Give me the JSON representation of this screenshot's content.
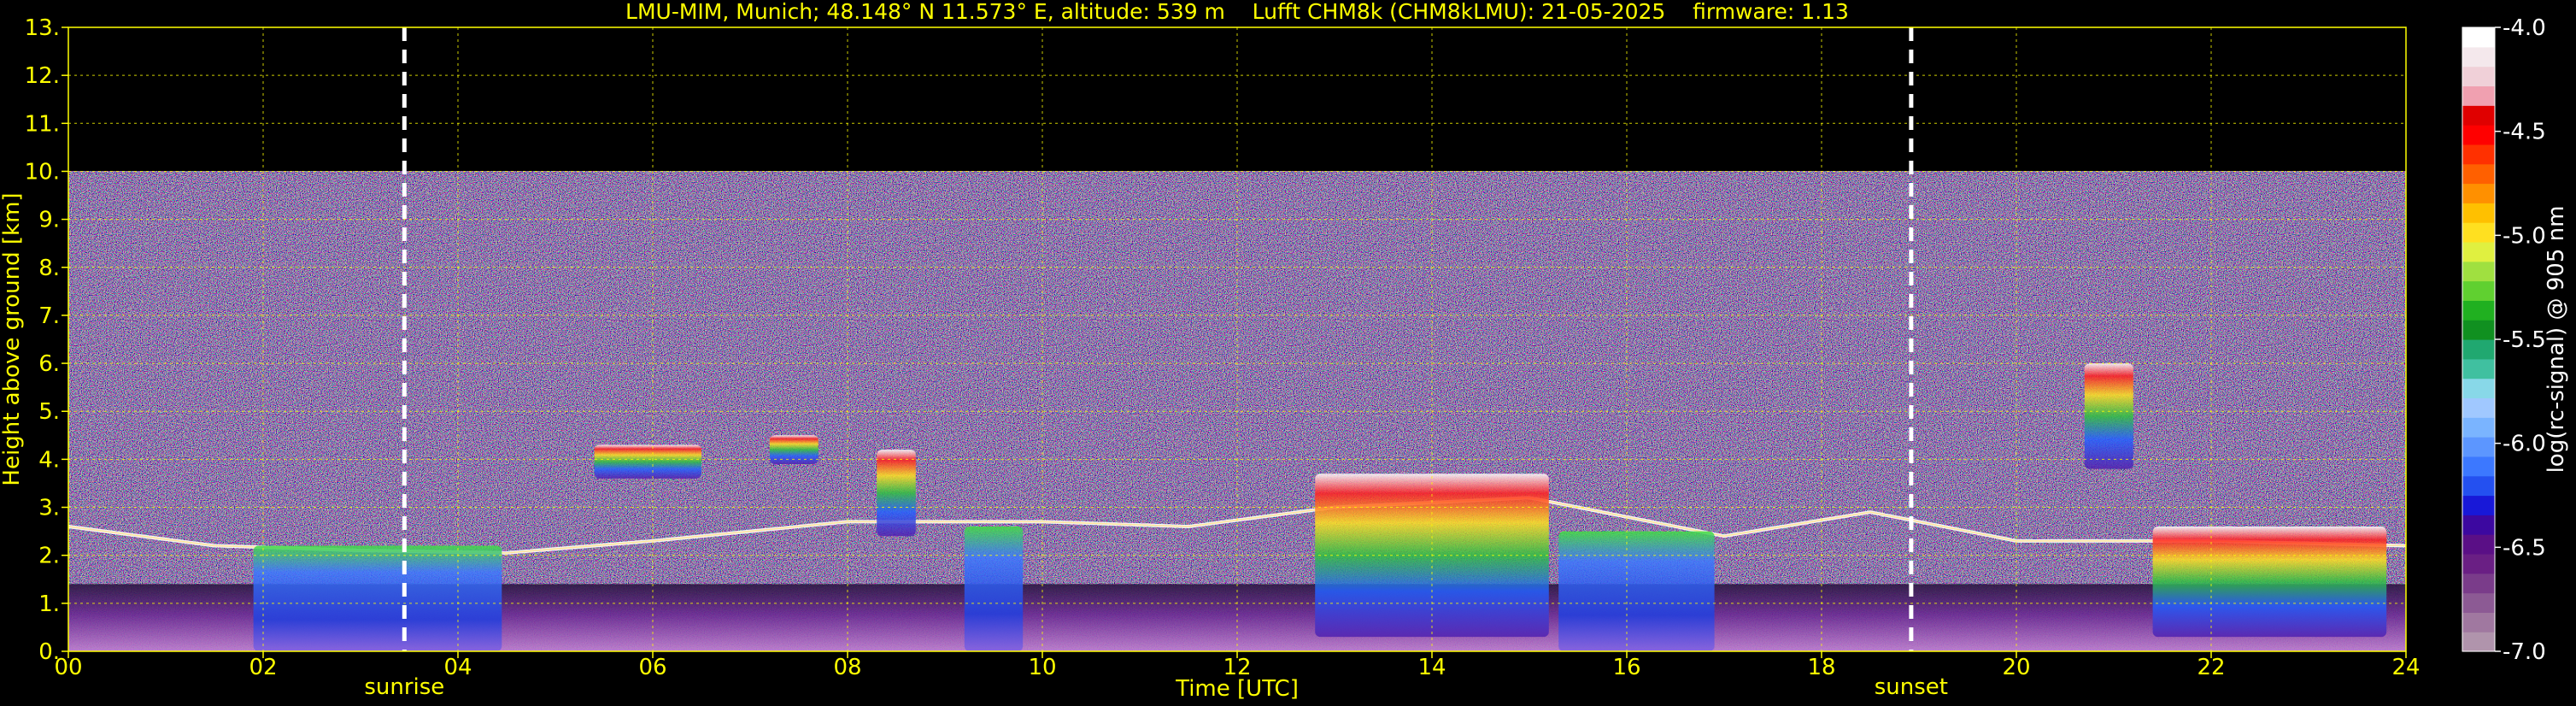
{
  "chart_data": {
    "type": "heatmap",
    "title": "LMU-MIM, Munich; 48.148° N 11.573° E, altitude: 539 m    Lufft CHM8k (CHM8kLMU): 21-05-2025    firmware: 1.13",
    "xlabel": "Time [UTC]",
    "ylabel": "Height above ground [km]",
    "xlim": [
      0,
      24
    ],
    "ylim": [
      0,
      13
    ],
    "x_ticks": [
      0,
      2,
      4,
      6,
      8,
      10,
      12,
      14,
      16,
      18,
      20,
      22,
      24
    ],
    "x_tick_labels": [
      "00",
      "02",
      "04",
      "06",
      "08",
      "10",
      "12",
      "14",
      "16",
      "18",
      "20",
      "22",
      "24"
    ],
    "y_ticks": [
      0,
      1,
      2,
      3,
      4,
      5,
      6,
      7,
      8,
      9,
      10,
      11,
      12,
      13
    ],
    "y_tick_labels": [
      "0.",
      "1.",
      "2.",
      "3.",
      "4.",
      "5.",
      "6.",
      "7.",
      "8.",
      "9.",
      "10.",
      "11.",
      "12.",
      "13."
    ],
    "grid": true,
    "data_top_km": 10.0,
    "annotations": [
      {
        "label": "sunrise",
        "x": 3.45
      },
      {
        "label": "sunset",
        "x": 18.92
      }
    ],
    "colorbar": {
      "label": "log(rc-signal) @ 905 nm",
      "range": [
        -7.0,
        -4.0
      ],
      "ticks": [
        -7.0,
        -6.5,
        -6.0,
        -5.5,
        -5.0,
        -4.5,
        -4.0
      ],
      "tick_labels": [
        "-7.0",
        "-6.5",
        "-6.0",
        "-5.5",
        "-5.0",
        "-4.5",
        "-4.0"
      ],
      "colors": [
        "#b094ac",
        "#a078a0",
        "#8c5a94",
        "#7a3c8a",
        "#6a1f84",
        "#5a0f86",
        "#3c08a0",
        "#1818d8",
        "#2450f0",
        "#3c78ff",
        "#5c96ff",
        "#7ab4ff",
        "#a0c8ff",
        "#88d8e8",
        "#40c0a0",
        "#20a870",
        "#109020",
        "#20b020",
        "#60d030",
        "#a0e040",
        "#e0f040",
        "#ffe020",
        "#ffc000",
        "#ff9000",
        "#ff6000",
        "#ff3000",
        "#ff0000",
        "#e00000",
        "#f0a0b0",
        "#f0d0d8",
        "#f4e8ec",
        "#ffffff"
      ]
    },
    "features": [
      {
        "type": "boundary_layer",
        "x": [
          0,
          1.5,
          3,
          4.5,
          6,
          8,
          10,
          11.5,
          13,
          15,
          17,
          18.5,
          20,
          22,
          24
        ],
        "base_km": [
          2.6,
          2.2,
          2.1,
          2.05,
          2.3,
          2.7,
          2.7,
          2.6,
          3.0,
          3.2,
          2.4,
          2.9,
          2.3,
          2.3,
          2.2
        ]
      },
      {
        "type": "cloud",
        "x_start": 1.9,
        "x_end": 4.45,
        "bottom_km": 0.0,
        "top_km": 2.2
      },
      {
        "type": "cloud",
        "x_start": 5.4,
        "x_end": 6.5,
        "bottom_km": 3.6,
        "top_km": 4.3
      },
      {
        "type": "cloud",
        "x_start": 7.2,
        "x_end": 7.7,
        "bottom_km": 3.9,
        "top_km": 4.5
      },
      {
        "type": "cloud",
        "x_start": 8.3,
        "x_end": 8.7,
        "bottom_km": 2.4,
        "top_km": 4.2
      },
      {
        "type": "cloud",
        "x_start": 9.2,
        "x_end": 9.8,
        "bottom_km": 0.0,
        "top_km": 2.6
      },
      {
        "type": "cloud",
        "x_start": 12.8,
        "x_end": 15.2,
        "bottom_km": 0.3,
        "top_km": 3.7
      },
      {
        "type": "cloud",
        "x_start": 15.3,
        "x_end": 16.9,
        "bottom_km": 0.0,
        "top_km": 2.5
      },
      {
        "type": "cloud",
        "x_start": 20.7,
        "x_end": 21.2,
        "bottom_km": 3.8,
        "top_km": 6.0
      },
      {
        "type": "cloud",
        "x_start": 21.4,
        "x_end": 23.8,
        "bottom_km": 0.3,
        "top_km": 2.6
      }
    ]
  }
}
